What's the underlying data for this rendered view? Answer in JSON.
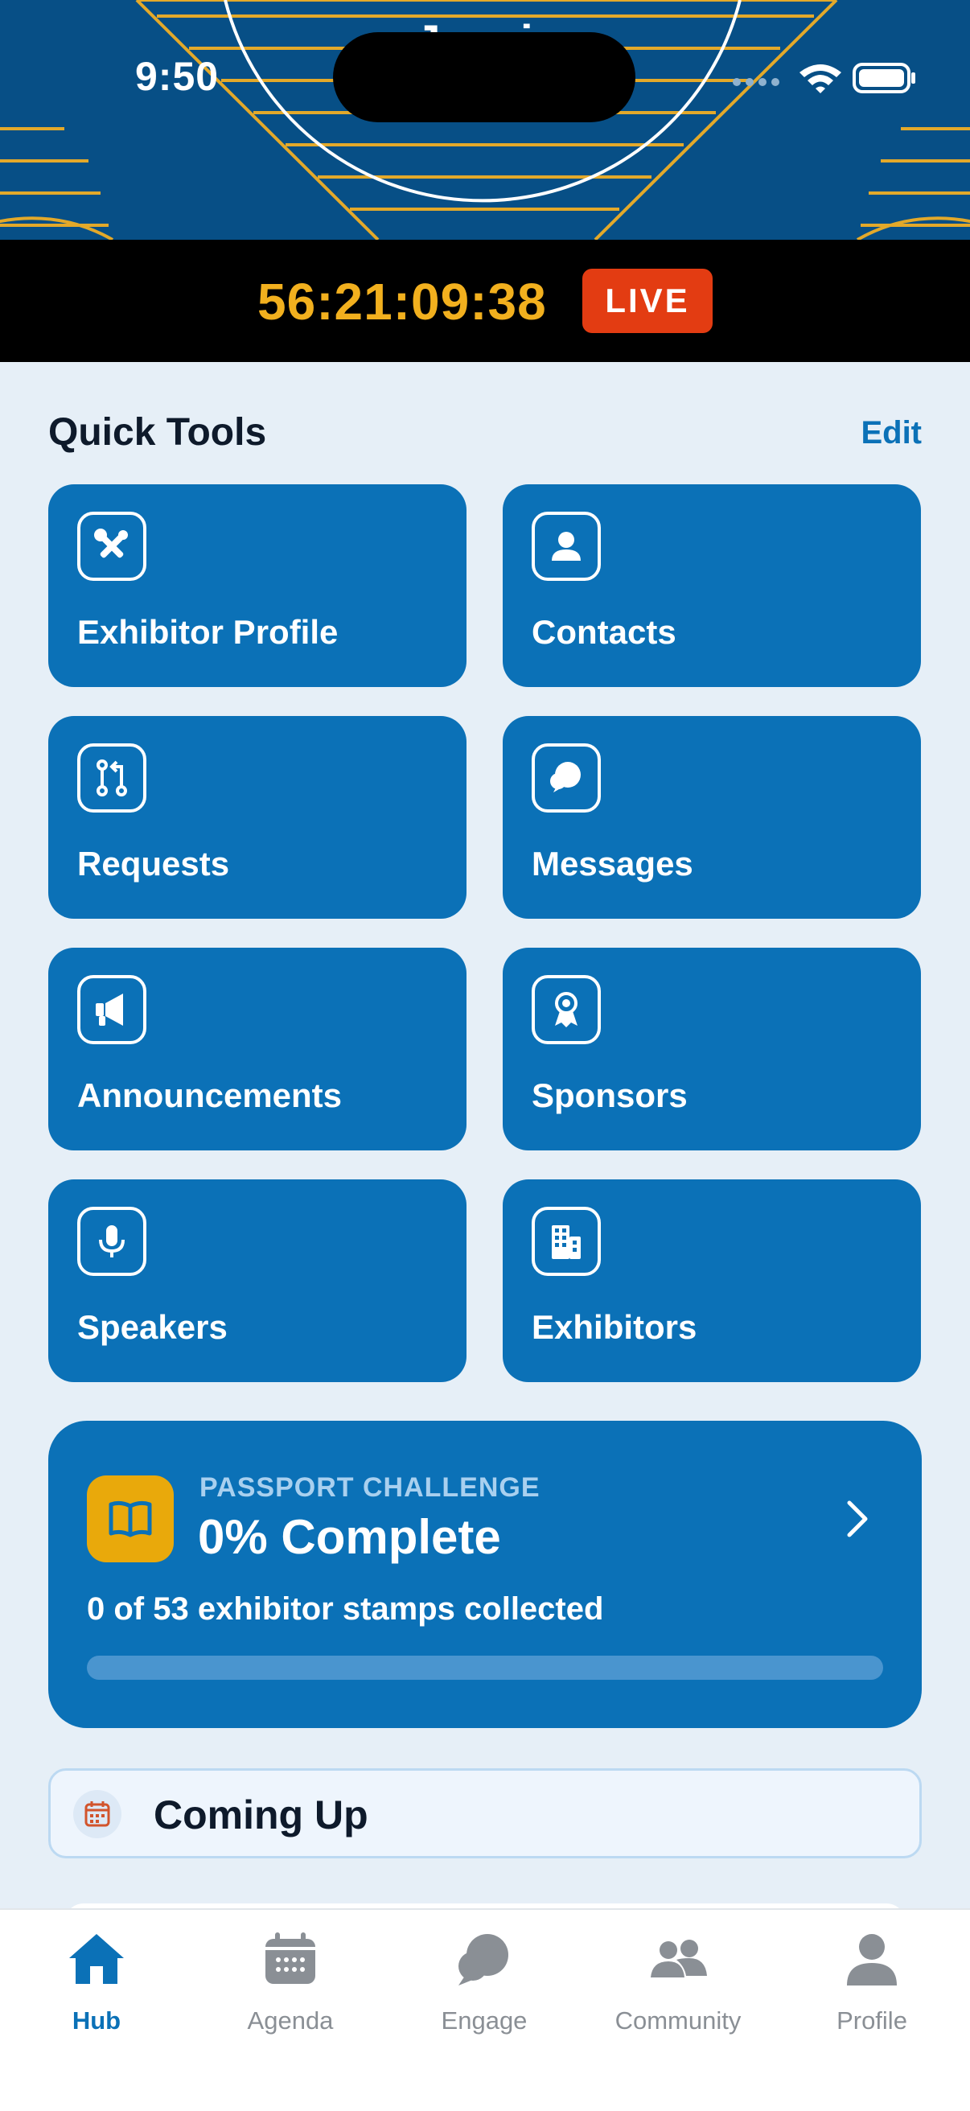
{
  "status_bar": {
    "time": "9:50"
  },
  "hero": {
    "title": "Jennie Christian"
  },
  "countdown": {
    "value": "56:21:09:38",
    "badge": "LIVE"
  },
  "quick_tools": {
    "title": "Quick Tools",
    "edit_label": "Edit",
    "tiles": [
      {
        "label": "Exhibitor Profile",
        "icon": "tools-icon"
      },
      {
        "label": "Contacts",
        "icon": "contact-icon"
      },
      {
        "label": "Requests",
        "icon": "requests-icon"
      },
      {
        "label": "Messages",
        "icon": "chat-icon"
      },
      {
        "label": "Announcements",
        "icon": "megaphone-icon"
      },
      {
        "label": "Sponsors",
        "icon": "award-icon"
      },
      {
        "label": "Speakers",
        "icon": "microphone-icon"
      },
      {
        "label": "Exhibitors",
        "icon": "building-icon"
      }
    ]
  },
  "passport": {
    "kicker": "PASSPORT CHALLENGE",
    "title": "0% Complete",
    "subtitle": "0 of 53 exhibitor stamps collected",
    "progress_fraction": 0
  },
  "coming_up": {
    "title": "Coming Up"
  },
  "tab_bar": {
    "tabs": [
      {
        "label": "Hub",
        "icon": "home-icon",
        "active": true
      },
      {
        "label": "Agenda",
        "icon": "calendar-icon",
        "active": false
      },
      {
        "label": "Engage",
        "icon": "chat-bubbles-icon",
        "active": false
      },
      {
        "label": "Community",
        "icon": "people-icon",
        "active": false
      },
      {
        "label": "Profile",
        "icon": "user-icon",
        "active": false
      }
    ]
  },
  "colors": {
    "brand_blue": "#0b71b7",
    "accent_gold": "#f2b01e",
    "live_red": "#e33c12",
    "hero_navy": "#074f86"
  }
}
